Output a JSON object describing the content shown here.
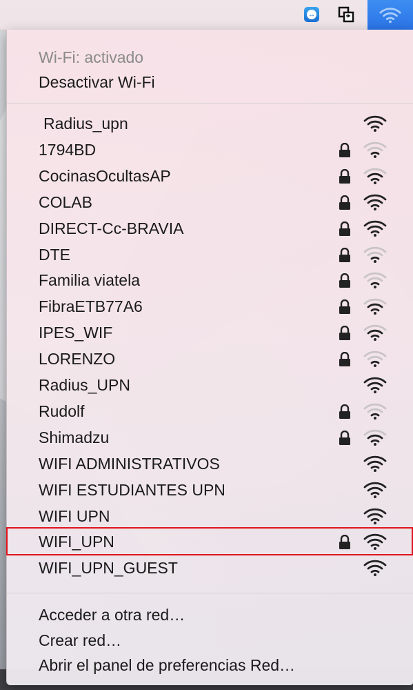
{
  "menubar": {
    "icons": [
      "teamviewer-icon",
      "window-switch-icon",
      "wifi-icon"
    ]
  },
  "status": {
    "label": "Wi-Fi: activado",
    "toggle_label": "Desactivar Wi-Fi"
  },
  "networks": [
    {
      "name": "Radius_upn",
      "locked": false,
      "signal": 3
    },
    {
      "name": "1794BD",
      "locked": true,
      "signal": 1
    },
    {
      "name": "CocinasOcultasAP",
      "locked": true,
      "signal": 2
    },
    {
      "name": "COLAB",
      "locked": true,
      "signal": 3
    },
    {
      "name": "DIRECT-Cc-BRAVIA",
      "locked": true,
      "signal": 3
    },
    {
      "name": "DTE",
      "locked": true,
      "signal": 1
    },
    {
      "name": "Familia viatela",
      "locked": true,
      "signal": 1
    },
    {
      "name": "FibraETB77A6",
      "locked": true,
      "signal": 2
    },
    {
      "name": "IPES_WIF",
      "locked": true,
      "signal": 2
    },
    {
      "name": "LORENZO",
      "locked": true,
      "signal": 1
    },
    {
      "name": "Radius_UPN",
      "locked": false,
      "signal": 3
    },
    {
      "name": "Rudolf",
      "locked": true,
      "signal": 1
    },
    {
      "name": "Shimadzu",
      "locked": true,
      "signal": 2
    },
    {
      "name": "WIFI ADMINISTRATIVOS",
      "locked": false,
      "signal": 3
    },
    {
      "name": "WIFI ESTUDIANTES UPN",
      "locked": false,
      "signal": 3
    },
    {
      "name": "WIFI UPN",
      "locked": false,
      "signal": 3
    },
    {
      "name": "WIFI_UPN",
      "locked": true,
      "signal": 3,
      "highlighted": true
    },
    {
      "name": "WIFI_UPN_GUEST",
      "locked": false,
      "signal": 3
    }
  ],
  "actions": {
    "other_network": "Acceder a otra red…",
    "create_network": "Crear red…",
    "open_prefs": "Abrir el panel de preferencias Red…"
  },
  "colors": {
    "highlight_border": "#e0141c",
    "wifi_active": "#2a74e6"
  }
}
